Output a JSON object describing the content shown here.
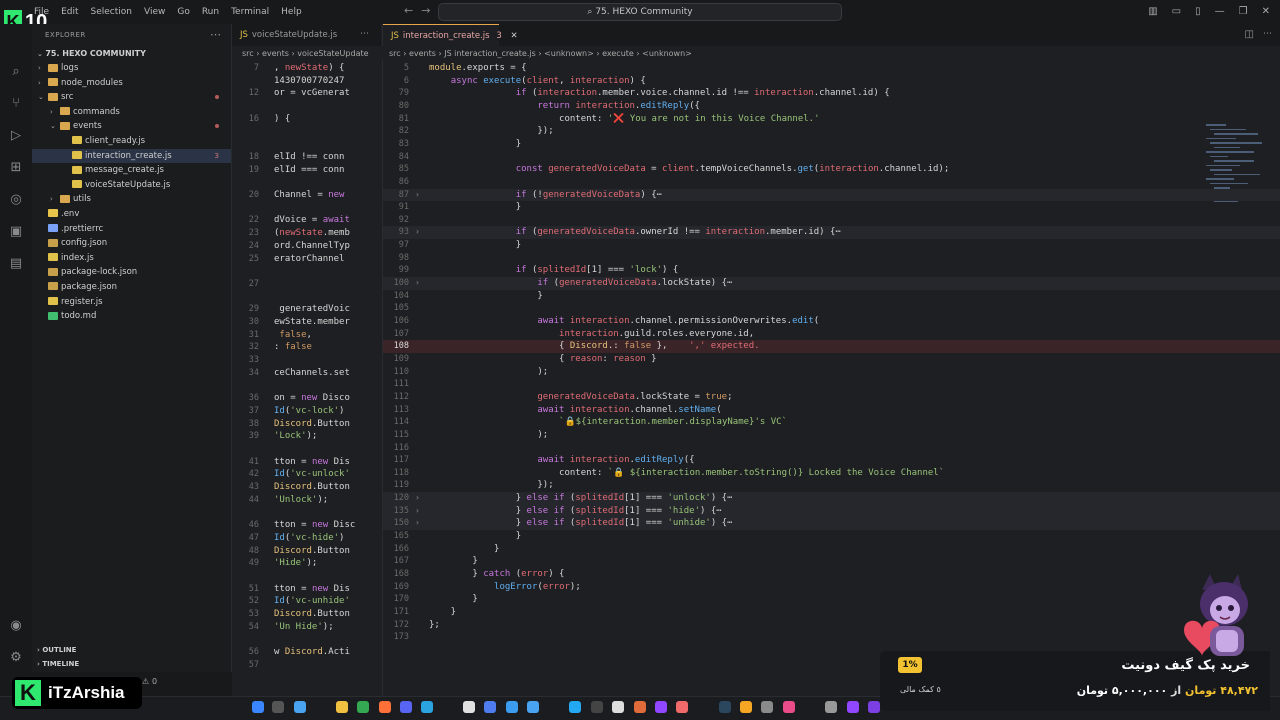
{
  "title_bar": {
    "menu": [
      "File",
      "Edit",
      "Selection",
      "View",
      "Go",
      "Run",
      "Terminal",
      "Help"
    ],
    "search": "75. HEXO Community",
    "logo_number": "10"
  },
  "explorer": {
    "header": "EXPLORER",
    "root": "75. HEXO COMMUNITY",
    "items": [
      {
        "label": "logs",
        "type": "folder",
        "depth": 1,
        "chev": "›"
      },
      {
        "label": "node_modules",
        "type": "folder",
        "depth": 1,
        "chev": "›"
      },
      {
        "label": "src",
        "type": "folder",
        "depth": 1,
        "chev": "⌄"
      },
      {
        "label": "commands",
        "type": "folder",
        "depth": 2,
        "chev": "›"
      },
      {
        "label": "events",
        "type": "folder",
        "depth": 2,
        "chev": "⌄"
      },
      {
        "label": "client_ready.js",
        "type": "js",
        "depth": 3,
        "chev": ""
      },
      {
        "label": "interaction_create.js",
        "type": "js",
        "depth": 3,
        "chev": "",
        "badge": "3",
        "selected": true
      },
      {
        "label": "message_create.js",
        "type": "js",
        "depth": 3,
        "chev": ""
      },
      {
        "label": "voiceStateUpdate.js",
        "type": "js",
        "depth": 3,
        "chev": ""
      },
      {
        "label": "utils",
        "type": "folder",
        "depth": 2,
        "chev": "›"
      },
      {
        "label": ".env",
        "type": "env",
        "depth": 1,
        "chev": ""
      },
      {
        "label": ".prettierrc",
        "type": "config",
        "depth": 1,
        "chev": ""
      },
      {
        "label": "config.json",
        "type": "json",
        "depth": 1,
        "chev": ""
      },
      {
        "label": "index.js",
        "type": "js",
        "depth": 1,
        "chev": ""
      },
      {
        "label": "package-lock.json",
        "type": "json",
        "depth": 1,
        "chev": ""
      },
      {
        "label": "package.json",
        "type": "json",
        "depth": 1,
        "chev": ""
      },
      {
        "label": "register.js",
        "type": "js",
        "depth": 1,
        "chev": ""
      },
      {
        "label": "todo.md",
        "type": "md",
        "depth": 1,
        "chev": ""
      }
    ],
    "outline": "OUTLINE",
    "timeline": "TIMELINE",
    "status": "0"
  },
  "left_group": {
    "tab": "voiceStateUpdate.js",
    "crumbs": "src › events › voiceStateUpdate",
    "lines": [
      {
        "n": "7",
        "c": ", newState) {"
      },
      {
        "n": "",
        "c": "1430700770247"
      },
      {
        "n": "12",
        "c": "or = vcGenerat"
      },
      {
        "n": "",
        "c": ""
      },
      {
        "n": "16",
        "c": ") {"
      },
      {
        "n": "",
        "c": ""
      },
      {
        "n": "",
        "c": ""
      },
      {
        "n": "18",
        "c": "elId !== conn"
      },
      {
        "n": "19",
        "c": "elId === conn"
      },
      {
        "n": "",
        "c": ""
      },
      {
        "n": "20",
        "c": "Channel = new"
      },
      {
        "n": "",
        "c": ""
      },
      {
        "n": "22",
        "c": "dVoice = await"
      },
      {
        "n": "23",
        "c": "(newState.memb"
      },
      {
        "n": "24",
        "c": "ord.ChannelTyp"
      },
      {
        "n": "25",
        "c": "eratorChannel"
      },
      {
        "n": "",
        "c": ""
      },
      {
        "n": "27",
        "c": ""
      },
      {
        "n": "",
        "c": ""
      },
      {
        "n": "29",
        "c": " generatedVoic"
      },
      {
        "n": "30",
        "c": "ewState.member"
      },
      {
        "n": "31",
        "c": " false,"
      },
      {
        "n": "32",
        "c": ": false"
      },
      {
        "n": "33",
        "c": ""
      },
      {
        "n": "34",
        "c": "ceChannels.set"
      },
      {
        "n": "",
        "c": ""
      },
      {
        "n": "36",
        "c": "on = new Disco"
      },
      {
        "n": "37",
        "c": "Id('vc-lock')"
      },
      {
        "n": "38",
        "c": "Discord.Button"
      },
      {
        "n": "39",
        "c": "'Lock');"
      },
      {
        "n": "",
        "c": ""
      },
      {
        "n": "41",
        "c": "tton = new Dis"
      },
      {
        "n": "42",
        "c": "Id('vc-unlock'"
      },
      {
        "n": "43",
        "c": "Discord.Button"
      },
      {
        "n": "44",
        "c": "'Unlock');"
      },
      {
        "n": "",
        "c": ""
      },
      {
        "n": "46",
        "c": "tton = new Disc"
      },
      {
        "n": "47",
        "c": "Id('vc-hide')"
      },
      {
        "n": "48",
        "c": "Discord.Button"
      },
      {
        "n": "49",
        "c": "'Hide');"
      },
      {
        "n": "",
        "c": ""
      },
      {
        "n": "51",
        "c": "tton = new Dis"
      },
      {
        "n": "52",
        "c": "Id('vc-unhide'"
      },
      {
        "n": "53",
        "c": "Discord.Button"
      },
      {
        "n": "54",
        "c": "'Un Hide');"
      },
      {
        "n": "",
        "c": ""
      },
      {
        "n": "56",
        "c": "w Discord.Acti"
      },
      {
        "n": "57",
        "c": ""
      }
    ]
  },
  "right_group": {
    "tab": "interaction_create.js",
    "tab_badge": "3",
    "crumbs": "src › events › JS interaction_create.js › <unknown> › execute › <unknown>",
    "lines": [
      {
        "n": "5",
        "c": "module.exports = {"
      },
      {
        "n": "6",
        "c": "    async execute(client, interaction) {"
      },
      {
        "n": "79",
        "c": "                if (interaction.member.voice.channel.id !== interaction.channel.id) {"
      },
      {
        "n": "80",
        "c": "                    return interaction.editReply({"
      },
      {
        "n": "81",
        "c": "                        content: '❌ You are not in this Voice Channel.'"
      },
      {
        "n": "82",
        "c": "                    });"
      },
      {
        "n": "83",
        "c": "                }"
      },
      {
        "n": "84",
        "c": ""
      },
      {
        "n": "85",
        "c": "                const generatedVoiceData = client.tempVoiceChannels.get(interaction.channel.id);"
      },
      {
        "n": "86",
        "c": ""
      },
      {
        "n": "87",
        "c": "                if (!generatedVoiceData) {⋯",
        "fold": true
      },
      {
        "n": "91",
        "c": "                }"
      },
      {
        "n": "92",
        "c": ""
      },
      {
        "n": "93",
        "c": "                if (generatedVoiceData.ownerId !== interaction.member.id) {⋯",
        "fold": true
      },
      {
        "n": "97",
        "c": "                }"
      },
      {
        "n": "98",
        "c": ""
      },
      {
        "n": "99",
        "c": "                if (splitedId[1] === 'lock') {"
      },
      {
        "n": "100",
        "c": "                    if (generatedVoiceData.lockState) {⋯",
        "fold": true
      },
      {
        "n": "104",
        "c": "                    }"
      },
      {
        "n": "105",
        "c": ""
      },
      {
        "n": "106",
        "c": "                    await interaction.channel.permissionOverwrites.edit("
      },
      {
        "n": "107",
        "c": "                        interaction.guild.roles.everyone.id,"
      },
      {
        "n": "108",
        "c": "                        { Discord.: false },    ',' expected.",
        "err": true
      },
      {
        "n": "109",
        "c": "                        { reason: reason }"
      },
      {
        "n": "110",
        "c": "                    );"
      },
      {
        "n": "111",
        "c": ""
      },
      {
        "n": "112",
        "c": "                    generatedVoiceData.lockState = true;"
      },
      {
        "n": "113",
        "c": "                    await interaction.channel.setName("
      },
      {
        "n": "114",
        "c": "                        `🔒${interaction.member.displayName}'s VC`"
      },
      {
        "n": "115",
        "c": "                    );"
      },
      {
        "n": "116",
        "c": ""
      },
      {
        "n": "117",
        "c": "                    await interaction.editReply({"
      },
      {
        "n": "118",
        "c": "                        content: `🔒 ${interaction.member.toString()} Locked the Voice Channel`"
      },
      {
        "n": "119",
        "c": "                    });"
      },
      {
        "n": "120",
        "c": "                } else if (splitedId[1] === 'unlock') {⋯",
        "fold": true
      },
      {
        "n": "135",
        "c": "                } else if (splitedId[1] === 'hide') {⋯",
        "fold": true
      },
      {
        "n": "150",
        "c": "                } else if (splitedId[1] === 'unhide') {⋯",
        "fold": true
      },
      {
        "n": "165",
        "c": "                }"
      },
      {
        "n": "166",
        "c": "            }"
      },
      {
        "n": "167",
        "c": "        }"
      },
      {
        "n": "168",
        "c": "        } catch (error) {"
      },
      {
        "n": "169",
        "c": "            logError(error);"
      },
      {
        "n": "170",
        "c": "        }"
      },
      {
        "n": "171",
        "c": "    }"
      },
      {
        "n": "172",
        "c": "};"
      },
      {
        "n": "173",
        "c": ""
      }
    ]
  },
  "overlay": {
    "brand": "iTzArshia",
    "donate_title": "خرید پک گیف دونیت",
    "donate_percent": "1%",
    "donate_help": "٥ کمک مالی",
    "donate_amount": "۴۸,۴۷۲",
    "donate_unit": "تومان",
    "donate_of": "از",
    "donate_goal": "۵,۰۰۰,۰۰۰",
    "donate_goal_unit": "تومان"
  },
  "colors": {
    "editor_bg": "#1e1f22",
    "keyword": "#c678dd",
    "function": "#61afef",
    "string": "#98c379",
    "error": "#e06c75",
    "accent_green": "#2ee86f"
  }
}
